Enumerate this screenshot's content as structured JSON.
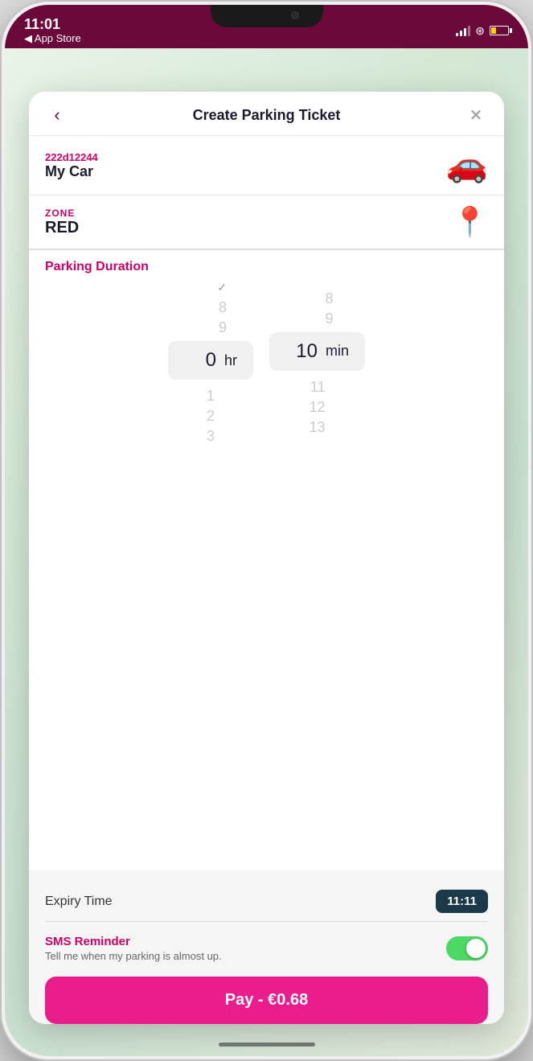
{
  "statusBar": {
    "time": "11:01",
    "appStore": "◀ App Store",
    "arrow": "▶"
  },
  "modal": {
    "title": "Create Parking Ticket",
    "backLabel": "‹",
    "closeLabel": "✕"
  },
  "vehicle": {
    "id": "222d12244",
    "name": "My Car"
  },
  "zone": {
    "label": "ZONE",
    "name": "RED"
  },
  "parkingDuration": {
    "title": "Parking Duration",
    "hoursFaded": [
      "8",
      "9"
    ],
    "hoursSelected": "0",
    "hoursUnit": "hr",
    "hoursBelow": [
      "1",
      "2",
      "3"
    ],
    "minutesFaded": [
      "8",
      "9"
    ],
    "minutesSelected": "10",
    "minutesUnit": "min",
    "minutesBelow": [
      "11",
      "12",
      "13"
    ]
  },
  "expiry": {
    "label": "Expiry Time",
    "time": "11:11"
  },
  "smsReminder": {
    "title": "SMS Reminder",
    "subtitle": "Tell me when my parking is almost up.",
    "toggleOn": true
  },
  "payButton": {
    "label": "Pay - €0.68"
  },
  "colors": {
    "brand": "#cc0066",
    "dark": "#1a1a2e",
    "statusBg": "#6b0a3a",
    "expiryBadge": "#1a3a4a",
    "toggleGreen": "#4cd964",
    "payPink": "#e91e8c"
  }
}
